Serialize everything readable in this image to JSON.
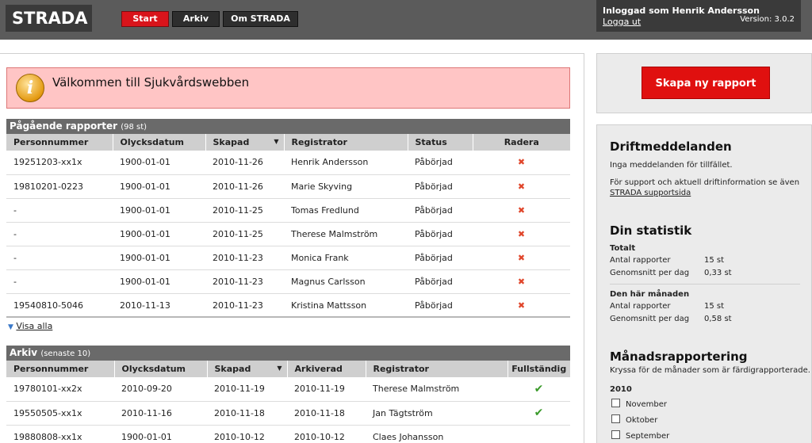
{
  "header": {
    "logo": "STRADA",
    "nav": [
      {
        "label": "Start"
      },
      {
        "label": "Arkiv"
      },
      {
        "label": "Om STRADA"
      }
    ],
    "user": {
      "logged_in": "Inloggad som Henrik Andersson",
      "logout": "Logga ut",
      "version": "Version: 3.0.2"
    }
  },
  "welcome": {
    "icon": "info-icon",
    "text": "Välkommen till Sjukvårdswebben"
  },
  "ongoing": {
    "title": "Pågående rapporter",
    "count": "(98 st)",
    "columns": [
      "Personnummer",
      "Olycksdatum",
      "Skapad",
      "Registrator",
      "Status",
      "Radera"
    ],
    "rows": [
      {
        "pnr": "19251203-xx1x",
        "olycksdatum": "1900-01-01",
        "skapad": "2010-11-26",
        "registrator": "Henrik Andersson",
        "status": "Påbörjad"
      },
      {
        "pnr": "19810201-0223",
        "olycksdatum": "1900-01-01",
        "skapad": "2010-11-26",
        "registrator": "Marie Skyving",
        "status": "Påbörjad"
      },
      {
        "pnr": "-",
        "olycksdatum": "1900-01-01",
        "skapad": "2010-11-25",
        "registrator": "Tomas Fredlund",
        "status": "Påbörjad"
      },
      {
        "pnr": "-",
        "olycksdatum": "1900-01-01",
        "skapad": "2010-11-25",
        "registrator": "Therese Malmström",
        "status": "Påbörjad"
      },
      {
        "pnr": "-",
        "olycksdatum": "1900-01-01",
        "skapad": "2010-11-23",
        "registrator": "Monica Frank",
        "status": "Påbörjad"
      },
      {
        "pnr": "-",
        "olycksdatum": "1900-01-01",
        "skapad": "2010-11-23",
        "registrator": "Magnus Carlsson",
        "status": "Påbörjad"
      },
      {
        "pnr": "19540810-5046",
        "olycksdatum": "2010-11-13",
        "skapad": "2010-11-23",
        "registrator": "Kristina Mattsson",
        "status": "Påbörjad"
      }
    ],
    "delete_glyph": "✖",
    "show_all": "Visa alla"
  },
  "archive": {
    "title": "Arkiv",
    "sub": "(senaste 10)",
    "columns": [
      "Personnummer",
      "Olycksdatum",
      "Skapad",
      "Arkiverad",
      "Registrator",
      "Fullständig"
    ],
    "rows": [
      {
        "pnr": "19780101-xx2x",
        "olycksdatum": "2010-09-20",
        "skapad": "2010-11-19",
        "arkiverad": "2010-11-19",
        "registrator": "Therese Malmström",
        "complete": "✔"
      },
      {
        "pnr": "19550505-xx1x",
        "olycksdatum": "2010-11-16",
        "skapad": "2010-11-18",
        "arkiverad": "2010-11-18",
        "registrator": "Jan Tägtström",
        "complete": "✔"
      },
      {
        "pnr": "19880808-xx1x",
        "olycksdatum": "1900-01-01",
        "skapad": "2010-10-12",
        "arkiverad": "2010-10-12",
        "registrator": "Claes Johansson",
        "complete": ""
      }
    ]
  },
  "sidebar": {
    "create_button": "Skapa ny rapport",
    "drift": {
      "title": "Driftmeddelanden",
      "none": "Inga meddelanden för tillfället.",
      "support_text": "För support och aktuell driftinformation se även",
      "support_link": "STRADA supportsida"
    },
    "stats": {
      "title": "Din statistik",
      "total_label": "Totalt",
      "month_label": "Den här månaden",
      "reports_label": "Antal rapporter",
      "avg_label": "Genomsnitt per dag",
      "total_reports": "15 st",
      "total_avg": "0,33 st",
      "month_reports": "15 st",
      "month_avg": "0,58 st"
    },
    "monthly": {
      "title": "Månadsrapportering",
      "desc": "Kryssa för de månader som är färdigrapporterade.",
      "year": "2010",
      "months": [
        "November",
        "Oktober",
        "September"
      ]
    }
  }
}
